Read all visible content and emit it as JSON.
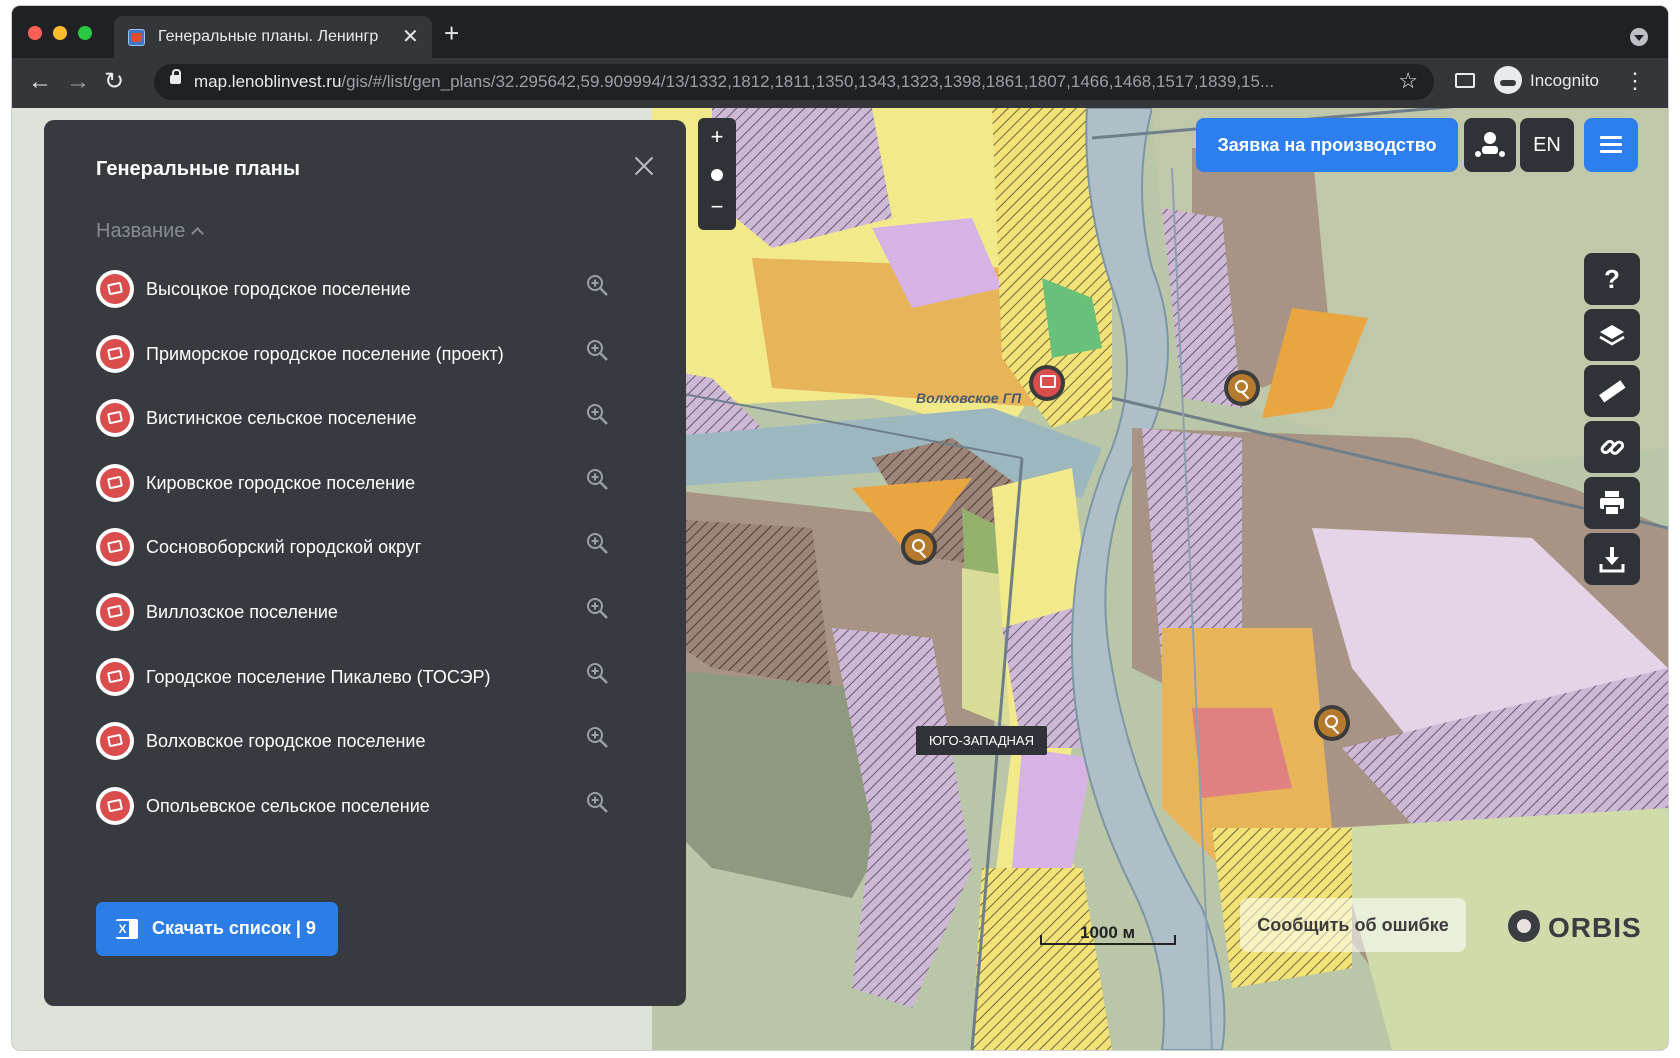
{
  "browser": {
    "tab_title": "Генеральные планы. Ленингр",
    "url_host": "map.lenoblinvest.ru",
    "url_path": "/gis/#/list/gen_plans/32.295642,59.909994/13/1332,1812,1811,1350,1343,1323,1398,1861,1807,1466,1468,1517,1839,15...",
    "profile_label": "Incognito",
    "close_tab_glyph": "✕",
    "new_tab_glyph": "+"
  },
  "panel": {
    "title": "Генеральные планы",
    "sort_label": "Название",
    "items": [
      {
        "label": "Высоцкое городское поселение"
      },
      {
        "label": "Приморское городское поселение (проект)"
      },
      {
        "label": "Вистинское сельское поселение"
      },
      {
        "label": "Кировское городское поселение"
      },
      {
        "label": "Сосновоборский городской округ"
      },
      {
        "label": "Виллозское поселение"
      },
      {
        "label": "Городское поселение Пикалево (ТОСЭР)"
      },
      {
        "label": "Волховское городское поселение"
      },
      {
        "label": "Опольевское сельское поселение"
      }
    ],
    "download_label": "Скачать список | 9"
  },
  "map": {
    "request_button": "Заявка на производство",
    "lang_button": "EN",
    "help_glyph": "?",
    "zoom_in": "+",
    "zoom_out": "−",
    "place_label": "ЮГО-ЗАПАДНАЯ",
    "water_label": "Волховское ГП",
    "scale_label": "1000 м",
    "report_button": "Сообщить об ошибке",
    "brand": "ORBIS"
  },
  "colors": {
    "panel_bg": "#373b40",
    "accent": "#2d7ff0",
    "plan_icon": "#d94d4d"
  }
}
